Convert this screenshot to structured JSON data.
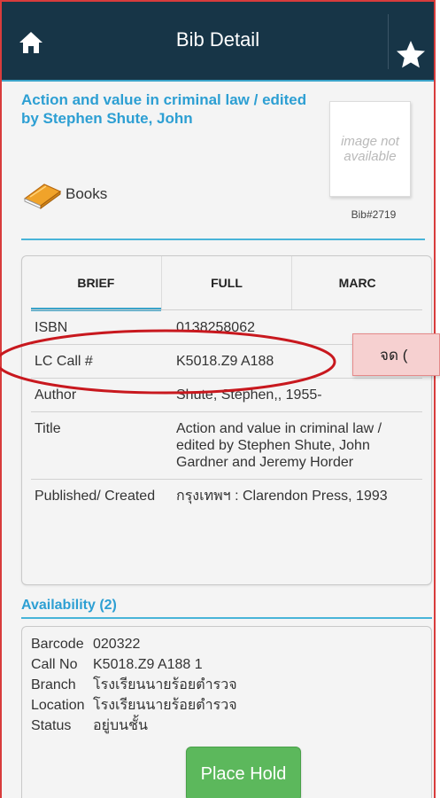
{
  "appbar": {
    "title": "Bib Detail"
  },
  "bib": {
    "title": "Action and value in criminal law / edited by Stephen Shute, John",
    "format": "Books",
    "image_placeholder": "image not available",
    "bib_number": "Bib#2719"
  },
  "tabs": [
    {
      "label": "BRIEF",
      "active": true
    },
    {
      "label": "FULL",
      "active": false
    },
    {
      "label": "MARC",
      "active": false
    }
  ],
  "details": [
    {
      "label": "ISBN",
      "value": "0138258062"
    },
    {
      "label": "LC Call #",
      "value": "K5018.Z9 A188"
    },
    {
      "label": "Author",
      "value": "Shute, Stephen,, 1955-"
    },
    {
      "label": "Title",
      "value": "Action and value in criminal law / edited by Stephen Shute, John Gardner and Jeremy Horder"
    },
    {
      "label": "Published/ Created",
      "value": "กรุงเทพฯ : Clarendon Press, 1993"
    }
  ],
  "annotation": {
    "callout_text": "จด ("
  },
  "availability": {
    "heading": "Availability (2)",
    "rows": [
      {
        "label": "Barcode",
        "value": "020322"
      },
      {
        "label": "Call No",
        "value": "K5018.Z9 A188 1"
      },
      {
        "label": "Branch",
        "value": "โรงเรียนนายร้อยตำรวจ"
      },
      {
        "label": "Location",
        "value": "โรงเรียนนายร้อยตำรวจ"
      },
      {
        "label": "Status",
        "value": "อยู่บนชั้น"
      }
    ],
    "place_hold_label": "Place Hold"
  },
  "colors": {
    "appbar_bg": "#173547",
    "accent_blue": "#2d9fd3",
    "hold_green": "#5cb85c",
    "annotation_red": "#c8181e"
  },
  "icons": [
    "home-icon",
    "star-icon",
    "book-icon"
  ]
}
